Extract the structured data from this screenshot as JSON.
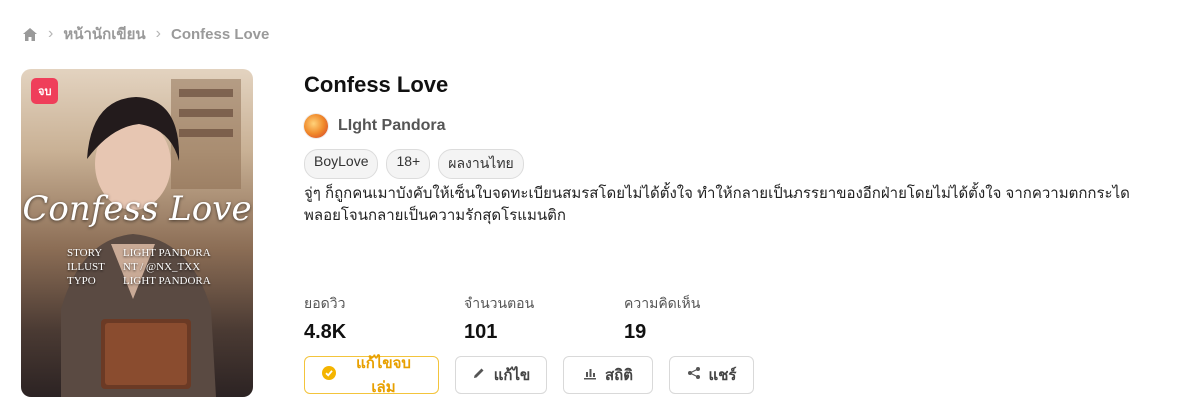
{
  "breadcrumb": {
    "items": [
      "หน้านักเขียน",
      "Confess Love"
    ]
  },
  "cover": {
    "badge": "จบ",
    "title": "Confess Love",
    "credits": [
      {
        "role": "STORY",
        "name": "LIGHT PANDORA"
      },
      {
        "role": "ILLUST",
        "name": "NT / @NX_TXX"
      },
      {
        "role": "TYPO",
        "name": "LIGHT PANDORA"
      }
    ]
  },
  "novel": {
    "title": "Confess Love",
    "author": "LIght Pandora",
    "tags": [
      "BoyLove",
      "18+",
      "ผลงานไทย"
    ],
    "synopsis": "จู่ๆ ก็ถูกคนเมาบังคับให้เซ็นใบจดทะเบียนสมรสโดยไม่ได้ตั้งใจ ทำให้กลายเป็นภรรยาของอีกฝ่ายโดยไม่ได้ตั้งใจ จากความตกกระไดพลอยโจนกลายเป็นความรักสุดโรแมนติก"
  },
  "stats": [
    {
      "label": "ยอดวิว",
      "value": "4.8K"
    },
    {
      "label": "จำนวนตอน",
      "value": "101"
    },
    {
      "label": "ความคิดเห็น",
      "value": "19"
    }
  ],
  "actions": {
    "finish_edit": "แก้ไขจบเล่ม",
    "edit": "แก้ไข",
    "stats": "สถิติ",
    "share": "แชร์"
  },
  "colors": {
    "badge": "#ef3e5a",
    "primary": "#e8a000"
  }
}
